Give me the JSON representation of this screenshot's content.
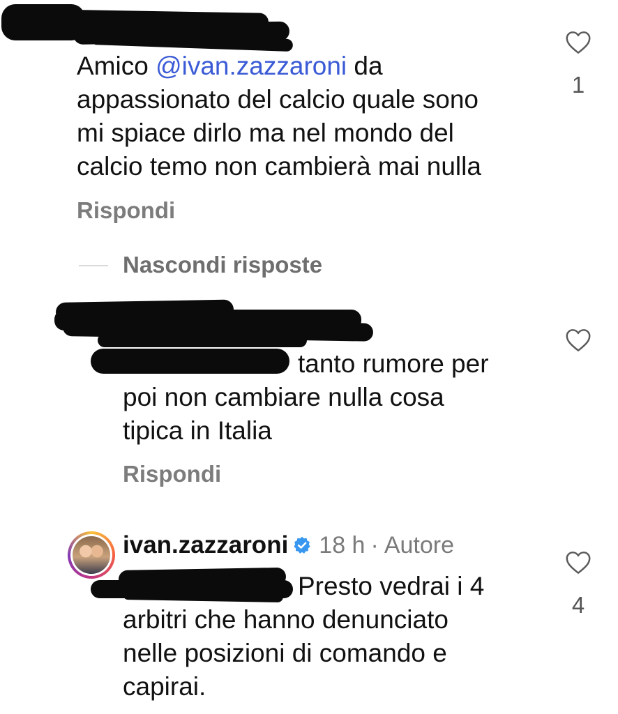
{
  "comment1": {
    "text_prefix": "Amico ",
    "mention": "@ivan.zazzaroni",
    "text_suffix": " da",
    "lines_rest": [
      "appassionato del calcio quale sono",
      "mi spiace dirlo ma nel mondo del",
      "calcio temo non cambierà mai nulla"
    ],
    "reply_label": "Rispondi",
    "like_count": "1"
  },
  "thread": {
    "hide_replies_label": "Nascondi risposte"
  },
  "reply1": {
    "lines": [
      "tanto rumore per",
      "poi non cambiare nulla cosa",
      "tipica in Italia"
    ],
    "reply_label": "Rispondi"
  },
  "reply2": {
    "username": "ivan.zazzaroni",
    "time": "18 h",
    "separator": "·",
    "role": "Autore",
    "lines": [
      "Presto vedrai i 4",
      "arbitri che hanno denunciato",
      "nelle posizioni di comando e",
      "capirai."
    ],
    "like_count": "4"
  },
  "colors": {
    "mention": "#3b5bd6",
    "secondary_text": "#7c7c7c",
    "verified": "#3897f0"
  },
  "icons": [
    "heart-outline-icon",
    "verified-badge-icon"
  ]
}
